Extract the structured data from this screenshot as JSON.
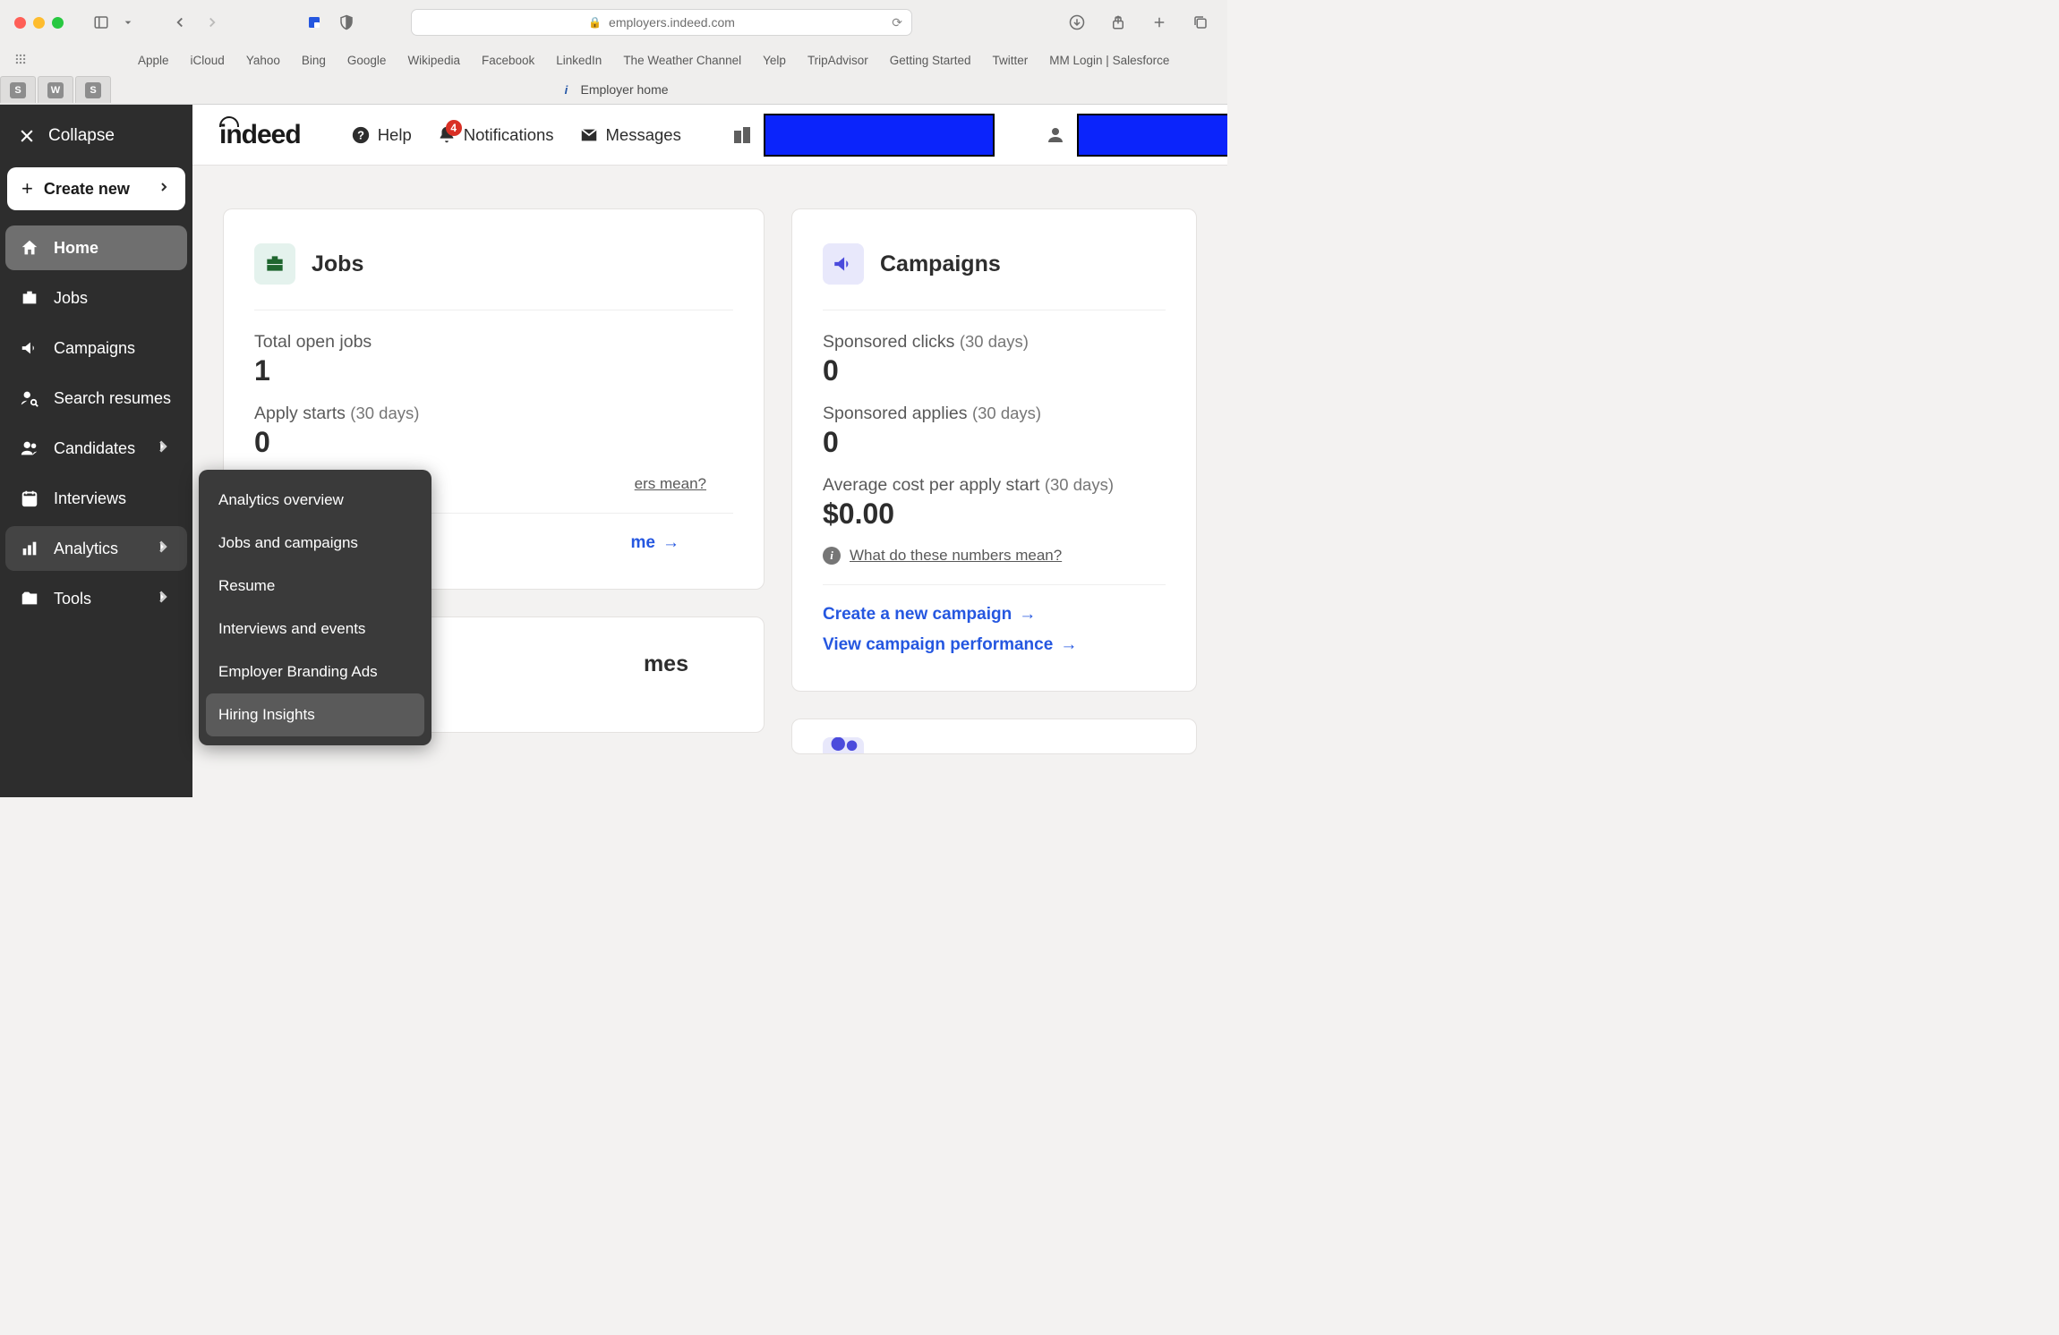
{
  "browser": {
    "url": "employers.indeed.com",
    "bookmarks": [
      "Apple",
      "iCloud",
      "Yahoo",
      "Bing",
      "Google",
      "Wikipedia",
      "Facebook",
      "LinkedIn",
      "The Weather Channel",
      "Yelp",
      "TripAdvisor",
      "Getting Started",
      "Twitter",
      "MM Login | Salesforce"
    ],
    "pinned_tabs": [
      "S",
      "W",
      "S"
    ],
    "tab_title": "Employer home"
  },
  "sidebar": {
    "collapse_label": "Collapse",
    "create_new_label": "Create new",
    "items": [
      {
        "label": "Home",
        "icon": "home",
        "active": true
      },
      {
        "label": "Jobs",
        "icon": "briefcase"
      },
      {
        "label": "Campaigns",
        "icon": "bullhorn"
      },
      {
        "label": "Search resumes",
        "icon": "person-search"
      },
      {
        "label": "Candidates",
        "icon": "people",
        "chevron": true
      },
      {
        "label": "Interviews",
        "icon": "calendar"
      },
      {
        "label": "Analytics",
        "icon": "bar-chart",
        "chevron": true,
        "expanded": true
      },
      {
        "label": "Tools",
        "icon": "folder",
        "chevron": true
      }
    ],
    "submenu": {
      "title": "Analytics",
      "items": [
        "Analytics overview",
        "Jobs and campaigns",
        "Resume",
        "Interviews and events",
        "Employer Branding Ads",
        "Hiring Insights"
      ],
      "hover_index": 5
    }
  },
  "topbar": {
    "logo_text": "indeed",
    "help_label": "Help",
    "notifications_label": "Notifications",
    "notifications_badge": "4",
    "messages_label": "Messages"
  },
  "cards": {
    "jobs": {
      "title": "Jobs",
      "stat1_label": "Total open jobs",
      "stat1_value": "1",
      "stat2_label": "Apply starts ",
      "stat2_light": "(30 days)",
      "stat2_value": "0",
      "info_link_partial": "ers mean?",
      "action_partial": "me"
    },
    "campaigns": {
      "title": "Campaigns",
      "stat1_label": "Sponsored clicks ",
      "stat1_light": "(30 days)",
      "stat1_value": "0",
      "stat2_label": "Sponsored applies ",
      "stat2_light": "(30 days)",
      "stat2_value": "0",
      "stat3_label": "Average cost per apply start ",
      "stat3_light": "(30 days)",
      "stat3_value": "$0.00",
      "info_link": "What do these numbers mean?",
      "action1": "Create a new campaign",
      "action2": "View campaign performance"
    },
    "resumes": {
      "title_partial": "mes"
    }
  }
}
